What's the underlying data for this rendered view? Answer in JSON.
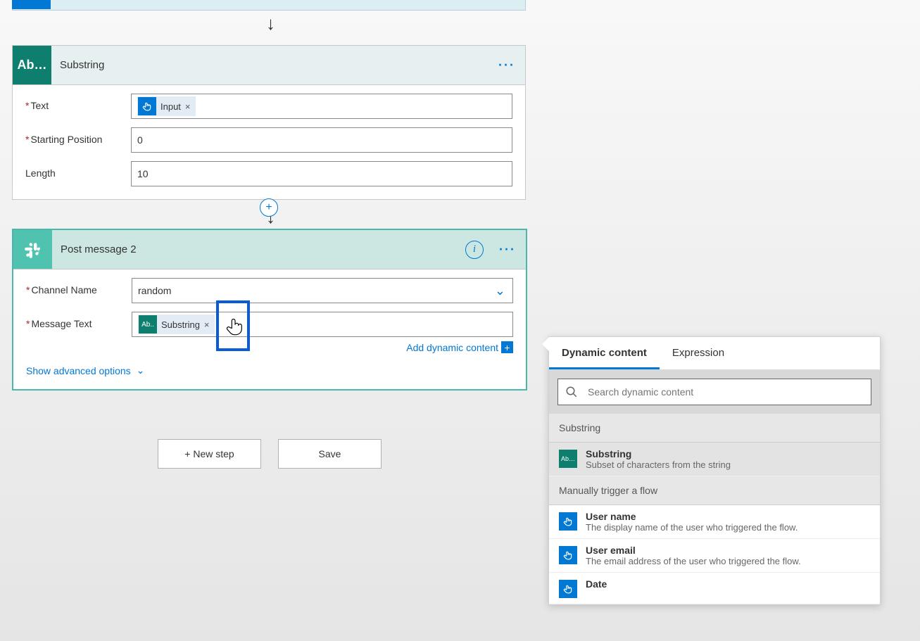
{
  "colors": {
    "teal": "#0e7e6e",
    "slack": "#50c2b0",
    "blue": "#0078d4"
  },
  "cards": {
    "substring": {
      "iconText": "Ab…",
      "title": "Substring",
      "fields": {
        "textLabel": "Text",
        "textToken": "Input",
        "startLabel": "Starting Position",
        "startValue": "0",
        "lengthLabel": "Length",
        "lengthValue": "10"
      }
    },
    "postmsg": {
      "title": "Post message 2",
      "fields": {
        "channelLabel": "Channel Name",
        "channelValue": "random",
        "msgLabel": "Message Text",
        "msgToken": "Substring"
      },
      "advOptions": "Show advanced options",
      "addDynamic": "Add dynamic content"
    }
  },
  "buttons": {
    "newstep": "+ New step",
    "save": "Save"
  },
  "panel": {
    "tabs": {
      "dynamic": "Dynamic content",
      "expression": "Expression"
    },
    "searchPlaceholder": "Search dynamic content",
    "sections": [
      {
        "title": "Substring",
        "color": "#0e7e6e",
        "iconText": "Ab…",
        "items": [
          {
            "title": "Substring",
            "subtitle": "Subset of characters from the string"
          }
        ]
      },
      {
        "title": "Manually trigger a flow",
        "color": "#0078d4",
        "items": [
          {
            "title": "User name",
            "subtitle": "The display name of the user who triggered the flow."
          },
          {
            "title": "User email",
            "subtitle": "The email address of the user who triggered the flow."
          },
          {
            "title": "Date",
            "subtitle": ""
          }
        ]
      }
    ]
  }
}
